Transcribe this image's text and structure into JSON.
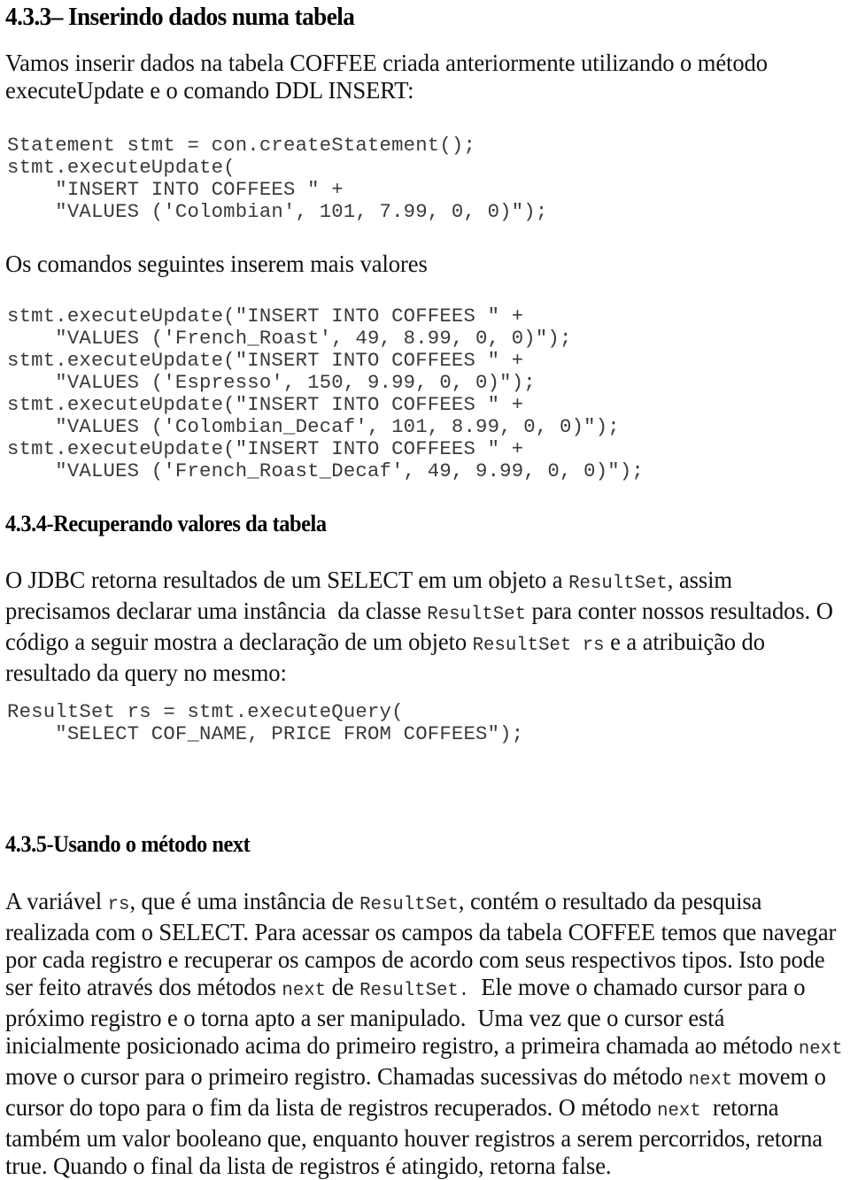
{
  "document": {
    "language": "pt-BR",
    "background_color": "#ffffff",
    "text_color": "#0a0a0a"
  },
  "headings": {
    "s433": "4.3.3– Inserindo dados numa tabela",
    "s434": "4.3.4-Recuperando valores da tabela",
    "s435": "4.3.5-Usando o método next"
  },
  "paragraphs": {
    "intro": {
      "line1": "Vamos inserir dados na tabela COFFEE criada anteriormente utilizando o método",
      "line2": "executeUpdate e o comando DDL INSERT:"
    },
    "seguintes": "Os comandos seguintes inserem mais valores",
    "resultset": {
      "l1a": "O JDBC retorna resultados de um SELECT em um objeto a ",
      "l1b": "ResultSet",
      "l1c": ", assim",
      "l2a": "precisamos declarar uma instância  da classe ",
      "l2b": "ResultSet",
      "l2c": " para conter nossos resultados. O",
      "l3a": "código a seguir mostra a declaração de um objeto ",
      "l3b": "ResultSet rs",
      "l3c": " e a atribuição do",
      "l4": "resultado da query no mesmo:"
    },
    "next": {
      "l1a": "A variável ",
      "l1b": "rs",
      "l1c": ", que é uma instância de ",
      "l1d": "ResultSet",
      "l1e": ", contém o resultado da pesquisa",
      "l2": "realizada com o SELECT. Para acessar os campos da tabela COFFEE temos que navegar",
      "l3": "por cada registro e recuperar os campos de acordo com seus respectivos tipos. Isto pode",
      "l4a": "ser feito através dos métodos ",
      "l4b": "next",
      "l4c": " de ",
      "l4d": "ResultSet.",
      "l4e": "  Ele move o chamado cursor para o",
      "l5": "próximo registro e o torna apto a ser manipulado.  Uma vez que o cursor está",
      "l6a": "inicialmente posicionado acima do primeiro registro, a primeira chamada ao método ",
      "l6b": "next",
      "l7a": "move o cursor para o primeiro registro. Chamadas sucessivas do método ",
      "l7b": "next",
      "l7c": " movem o",
      "l8a": "cursor do topo para o fim da lista de registros recuperados. O método ",
      "l8b": "next",
      "l8c": "  retorna",
      "l9": "também um valor booleano que, enquanto houver registros a serem percorridos, retorna",
      "l10": "true. Quando o final da lista de registros é atingido, retorna false."
    }
  },
  "code_blocks": {
    "insert_first": "Statement stmt = con.createStatement();\nstmt.executeUpdate(\n    \"INSERT INTO COFFEES \" +\n    \"VALUES ('Colombian', 101, 7.99, 0, 0)\");",
    "insert_more": "stmt.executeUpdate(\"INSERT INTO COFFEES \" +\n    \"VALUES ('French_Roast', 49, 8.99, 0, 0)\");\nstmt.executeUpdate(\"INSERT INTO COFFEES \" +\n    \"VALUES ('Espresso', 150, 9.99, 0, 0)\");\nstmt.executeUpdate(\"INSERT INTO COFFEES \" +\n    \"VALUES ('Colombian_Decaf', 101, 8.99, 0, 0)\");\nstmt.executeUpdate(\"INSERT INTO COFFEES \" +\n    \"VALUES ('French_Roast_Decaf', 49, 9.99, 0, 0)\");",
    "select_query": "ResultSet rs = stmt.executeQuery(\n    \"SELECT COF_NAME, PRICE FROM COFFEES\");"
  },
  "coffee_rows": [
    {
      "name": "Colombian",
      "sup_id": 101,
      "price": 7.99,
      "sales": 0,
      "total": 0
    },
    {
      "name": "French_Roast",
      "sup_id": 49,
      "price": 8.99,
      "sales": 0,
      "total": 0
    },
    {
      "name": "Espresso",
      "sup_id": 150,
      "price": 9.99,
      "sales": 0,
      "total": 0
    },
    {
      "name": "Colombian_Decaf",
      "sup_id": 101,
      "price": 8.99,
      "sales": 0,
      "total": 0
    },
    {
      "name": "French_Roast_Decaf",
      "sup_id": 49,
      "price": 9.99,
      "sales": 0,
      "total": 0
    }
  ]
}
